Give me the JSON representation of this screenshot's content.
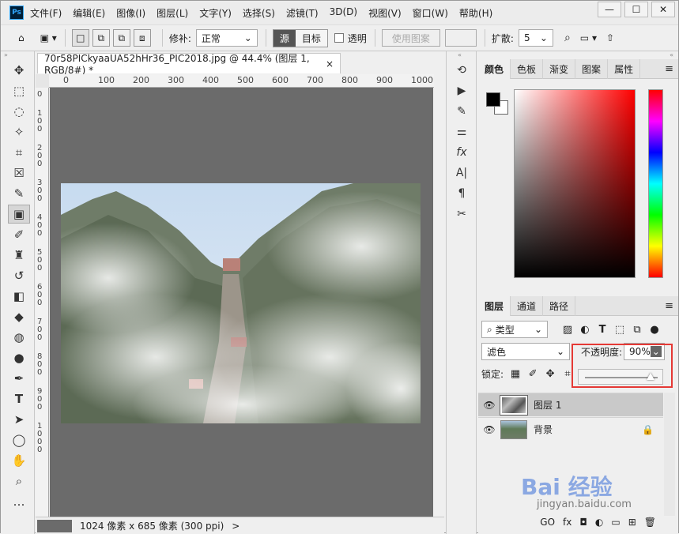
{
  "app": {
    "logo": "Ps"
  },
  "menu": [
    "文件(F)",
    "编辑(E)",
    "图像(I)",
    "图层(L)",
    "文字(Y)",
    "选择(S)",
    "滤镜(T)",
    "3D(D)",
    "视图(V)",
    "窗口(W)",
    "帮助(H)"
  ],
  "window_controls": {
    "minimize": "—",
    "maximize": "☐",
    "close": "✕"
  },
  "options": {
    "repair_label": "修补:",
    "repair_value": "正常",
    "source_label": "源",
    "target_label": "目标",
    "transparent_label": "透明",
    "use_pattern_label": "使用图案",
    "diffuse_label": "扩散:",
    "diffuse_value": "5"
  },
  "document": {
    "tab_title": "70r58PICkyaaUA52hHr36_PIC2018.jpg @ 44.4% (图层 1, RGB/8#) *",
    "tab_close": "×",
    "ruler_h": [
      "0",
      "100",
      "200",
      "300",
      "400",
      "500",
      "600",
      "700",
      "800",
      "900",
      "1000"
    ],
    "ruler_v": [
      "0",
      "1 0 0",
      "2 0 0",
      "3 0 0",
      "4 0 0",
      "5 0 0",
      "6 0 0",
      "7 0 0",
      "8 0 0",
      "9 0 0",
      "1 0 0 0"
    ],
    "status": "1024 像素 x 685 像素 (300 ppi)",
    "status_arrow": ">"
  },
  "color_panel": {
    "tabs": [
      "颜色",
      "色板",
      "渐变",
      "图案",
      "属性"
    ],
    "menu": "≡"
  },
  "layers_panel": {
    "tabs": [
      "图层",
      "通道",
      "路径"
    ],
    "filter_label": "类型",
    "blend_mode": "滤色",
    "opacity_label": "不透明度:",
    "opacity_value": "90%",
    "opacity_level": 0.9,
    "lock_label": "锁定:",
    "layers": [
      {
        "name": "图层 1",
        "selected": true,
        "locked": false
      },
      {
        "name": "背景",
        "selected": false,
        "locked": true
      }
    ],
    "footer": [
      "GO",
      "fx",
      "◘",
      "◐",
      "▭",
      "⊞",
      "🗑"
    ]
  },
  "colors": {
    "canvas_bg": "#6b6b6b",
    "highlight": "#e53935",
    "selected_layer": "#c9c9c9",
    "foreground": "#000000",
    "background": "#ffffff"
  },
  "watermark": {
    "text": "Bai 经验",
    "url": "jingyan.baidu.com"
  }
}
